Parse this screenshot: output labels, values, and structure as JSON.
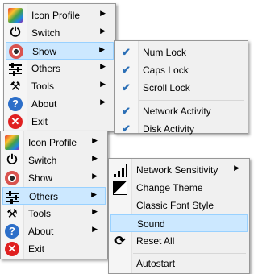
{
  "menu_top": {
    "items": [
      {
        "label": "Icon Profile",
        "icon": "color-profile-icon",
        "submenu": true
      },
      {
        "label": "Switch",
        "icon": "power-icon",
        "submenu": true
      },
      {
        "label": "Show",
        "icon": "eye-icon",
        "submenu": true,
        "selected": true
      },
      {
        "label": "Others",
        "icon": "sliders-icon",
        "submenu": true
      },
      {
        "label": "Tools",
        "icon": "tools-icon",
        "submenu": true
      },
      {
        "label": "About",
        "icon": "help-icon",
        "submenu": true
      },
      {
        "label": "Exit",
        "icon": "exit-icon",
        "submenu": false
      }
    ]
  },
  "show_submenu": {
    "items": [
      {
        "label": "Num Lock",
        "checked": true
      },
      {
        "label": "Caps Lock",
        "checked": true
      },
      {
        "label": "Scroll Lock",
        "checked": true
      },
      {
        "label": "Network Activity",
        "checked": true
      },
      {
        "label": "Disk Activity",
        "checked": true
      }
    ]
  },
  "menu_bottom": {
    "items": [
      {
        "label": "Icon Profile",
        "icon": "color-profile-icon",
        "submenu": true
      },
      {
        "label": "Switch",
        "icon": "power-icon",
        "submenu": true
      },
      {
        "label": "Show",
        "icon": "eye-icon",
        "submenu": true
      },
      {
        "label": "Others",
        "icon": "sliders-icon",
        "submenu": true,
        "selected": true
      },
      {
        "label": "Tools",
        "icon": "tools-icon",
        "submenu": true
      },
      {
        "label": "About",
        "icon": "help-icon",
        "submenu": true
      },
      {
        "label": "Exit",
        "icon": "exit-icon",
        "submenu": false
      }
    ]
  },
  "others_submenu": {
    "items": [
      {
        "label": "Network Sensitivity",
        "icon": "signal-bars-icon",
        "submenu": true
      },
      {
        "label": "Change Theme",
        "icon": "theme-icon",
        "submenu": false
      },
      {
        "label": "Classic Font Style",
        "icon": "",
        "submenu": false
      },
      {
        "label": "Sound",
        "icon": "",
        "submenu": false,
        "selected": true
      },
      {
        "label": "Reset All",
        "icon": "reset-icon",
        "submenu": false
      },
      {
        "label": "Autostart",
        "icon": "",
        "submenu": false
      }
    ]
  },
  "glyphs": {
    "arrow": "▶",
    "check": "✔",
    "power": "⏻",
    "tools": "⚒",
    "help": "?",
    "exit": "✕",
    "reset": "⟳"
  },
  "colors": {
    "selection_bg": "#cce8ff",
    "selection_border": "#99d1ff",
    "check": "#2b6fb6"
  }
}
